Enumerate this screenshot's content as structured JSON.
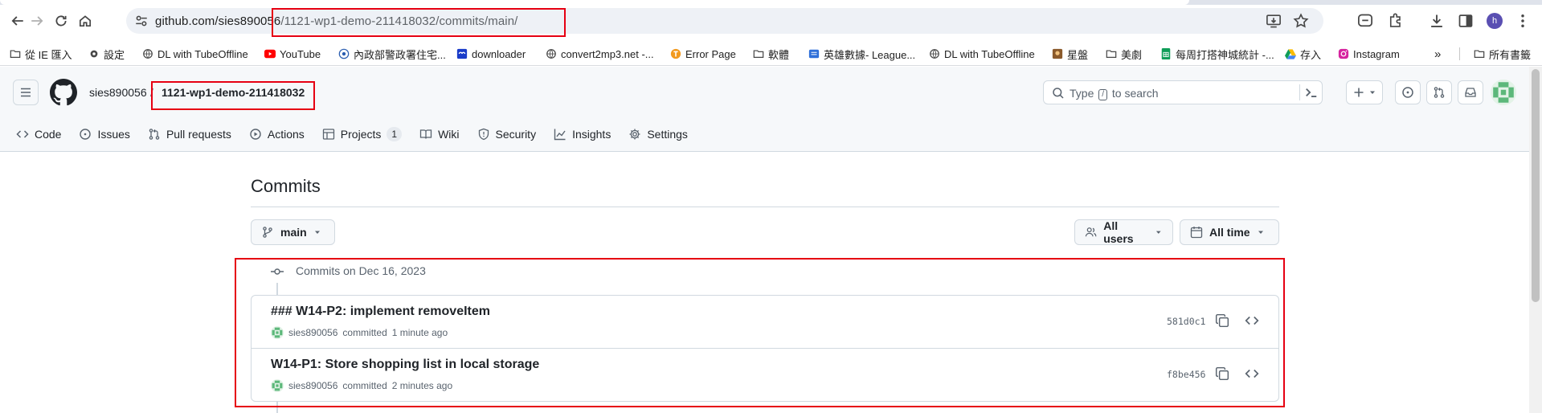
{
  "browser": {
    "url_host": "github.com/sies890056",
    "url_path": "/1121-wp1-demo-211418032/commits/main/",
    "profile_initial": "h"
  },
  "bookmarks": [
    {
      "label": "從 IE 匯入",
      "icon": "folder-icon"
    },
    {
      "label": "設定",
      "icon": "gear-icon"
    },
    {
      "label": "DL with TubeOffline",
      "icon": "globe-icon"
    },
    {
      "label": "YouTube",
      "icon": "youtube-icon"
    },
    {
      "label": "內政部警政署住宅...",
      "icon": "police-badge-icon"
    },
    {
      "label": "downloader",
      "icon": "downloader-icon"
    },
    {
      "label": "convert2mp3.net -...",
      "icon": "globe-icon"
    },
    {
      "label": "Error Page",
      "icon": "error-page-icon"
    },
    {
      "label": "軟體",
      "icon": "folder-icon"
    },
    {
      "label": "英雄數據- League...",
      "icon": "league-icon"
    },
    {
      "label": "DL with TubeOffline",
      "icon": "globe-icon"
    },
    {
      "label": "星盤",
      "icon": "astro-icon"
    },
    {
      "label": "美劇",
      "icon": "folder-icon"
    },
    {
      "label": "每周打搭神城統計 -...",
      "icon": "sheets-icon"
    },
    {
      "label": "存入",
      "icon": "drive-icon"
    },
    {
      "label": "Instagram",
      "icon": "instagram-icon"
    }
  ],
  "bookmarks_overflow": "»",
  "bookmarks_all": "所有書籤",
  "github": {
    "owner": "sies890056",
    "separator": "/",
    "repo": "1121-wp1-demo-211418032",
    "search_prefix": "Type",
    "search_key": "/",
    "search_suffix": "to search",
    "nav": [
      {
        "label": "Code",
        "icon": "code-icon"
      },
      {
        "label": "Issues",
        "icon": "issue-icon"
      },
      {
        "label": "Pull requests",
        "icon": "pull-request-icon"
      },
      {
        "label": "Actions",
        "icon": "play-icon"
      },
      {
        "label": "Projects",
        "icon": "table-icon",
        "count": "1"
      },
      {
        "label": "Wiki",
        "icon": "book-icon"
      },
      {
        "label": "Security",
        "icon": "shield-icon"
      },
      {
        "label": "Insights",
        "icon": "graph-icon"
      },
      {
        "label": "Settings",
        "icon": "gear-icon"
      }
    ]
  },
  "commits_page": {
    "title": "Commits",
    "branch": "main",
    "users_filter": "All users",
    "time_filter": "All time",
    "group_date": "Commits on Dec 16, 2023",
    "commits": [
      {
        "message": "### W14-P2: implement removeItem",
        "author": "sies890056",
        "committed_label": "committed",
        "time": "1 minute ago",
        "sha": "581d0c1"
      },
      {
        "message": "W14-P1: Store shopping list in local storage",
        "author": "sies890056",
        "committed_label": "committed",
        "time": "2 minutes ago",
        "sha": "f8be456"
      }
    ]
  },
  "colors": {
    "annotation": "#e60012",
    "link": "#0969da",
    "muted": "#59636e"
  }
}
